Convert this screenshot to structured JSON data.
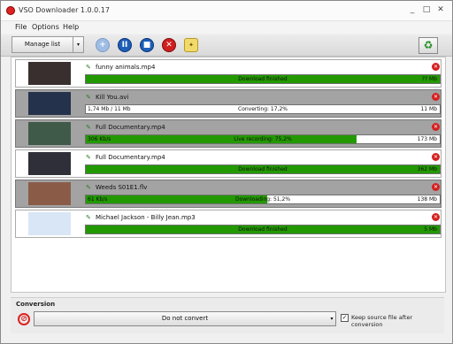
{
  "window": {
    "title": "VSO Downloader 1.0.0.17",
    "minimize": "_",
    "maximize": "□",
    "close": "✕"
  },
  "menu": [
    {
      "label": "File"
    },
    {
      "label": "Options"
    },
    {
      "label": "Help"
    }
  ],
  "toolbar": {
    "manage_list": "Manage list",
    "dropdown": "▾",
    "add_icon": "+",
    "pause_icon": "II",
    "stop_icon": "■",
    "cancel_icon": "✕",
    "clean_icon": "✦",
    "recycle_icon": "♻"
  },
  "downloads": [
    {
      "filename": "funny animals.mp4",
      "bar_left": "",
      "bar_center": "Download finished",
      "bar_right": "?? Mb",
      "progress": 1.0,
      "selected": false,
      "thumb": "#3a2f2f"
    },
    {
      "filename": "Kill You.avi",
      "bar_left": "1,74 Mb / 11 Mb",
      "bar_center": "Converting: 17,2%",
      "bar_right": "11 Mb",
      "progress": 0.0,
      "selected": true,
      "thumb": "#24324b"
    },
    {
      "filename": "Full Documentary.mp4",
      "bar_left": "306 Kb/s",
      "bar_center": "Live recording: 75,2%",
      "bar_right": "173 Mb",
      "progress": 0.765,
      "selected": true,
      "thumb": "#3f5a48"
    },
    {
      "filename": "Full Documentary.mp4",
      "bar_left": "",
      "bar_center": "Download finished",
      "bar_right": "362 Mb",
      "progress": 1.0,
      "selected": false,
      "thumb": "#2f2f3a"
    },
    {
      "filename": "Weeds S01E1.flv",
      "bar_left": "61 Kb/s",
      "bar_center": "Downloading: 51,2%",
      "bar_right": "138 Mb",
      "progress": 0.512,
      "selected": true,
      "thumb": "#8a5c48"
    },
    {
      "filename": "Michael Jackson - Billy Jean.mp3",
      "bar_left": "",
      "bar_center": "Download finished",
      "bar_right": "5 Mb",
      "progress": 1.0,
      "selected": false,
      "thumb": "#d8e6f5"
    }
  ],
  "conversion": {
    "label": "Conversion",
    "no_icon": "⊘",
    "selected": "Do not convert",
    "arrow": "▾",
    "keep_label": "Keep source file after conversion",
    "keep_checked": "✓"
  },
  "colors": {
    "progress_fill": "#229900",
    "selected_row": "#a3a3a3"
  }
}
